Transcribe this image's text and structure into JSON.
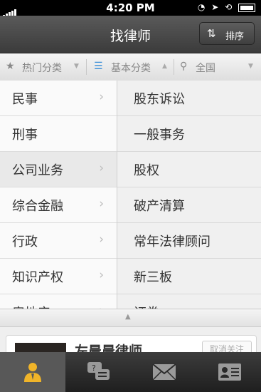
{
  "status_bar": {
    "time": "4:20 PM"
  },
  "nav": {
    "title": "找律师",
    "sort_label": "排序"
  },
  "filters": [
    {
      "label": "热门分类",
      "icon": "star-icon"
    },
    {
      "label": "基本分类",
      "icon": "list-icon"
    },
    {
      "label": "全国",
      "icon": "location-pin-icon"
    }
  ],
  "categories": [
    "民事",
    "刑事",
    "公司业务",
    "综合金融",
    "行政",
    "知识产权",
    "房地产"
  ],
  "subcategories": [
    "股东诉讼",
    "一般事务",
    "股权",
    "破产清算",
    "常年法律顾问",
    "新三板",
    "证券"
  ],
  "card": {
    "lawyer_name": "左晨晨律师",
    "unfollow_label": "取消关注"
  },
  "tabbar": [
    "lawyer-icon",
    "consult-chat-icon",
    "mail-icon",
    "contact-card-icon"
  ],
  "colors": {
    "navbar": "#3b3b3b",
    "tabbar": "#1f1f1f",
    "tab_active": "#585858",
    "lawyer_icon": "#f0b429"
  }
}
